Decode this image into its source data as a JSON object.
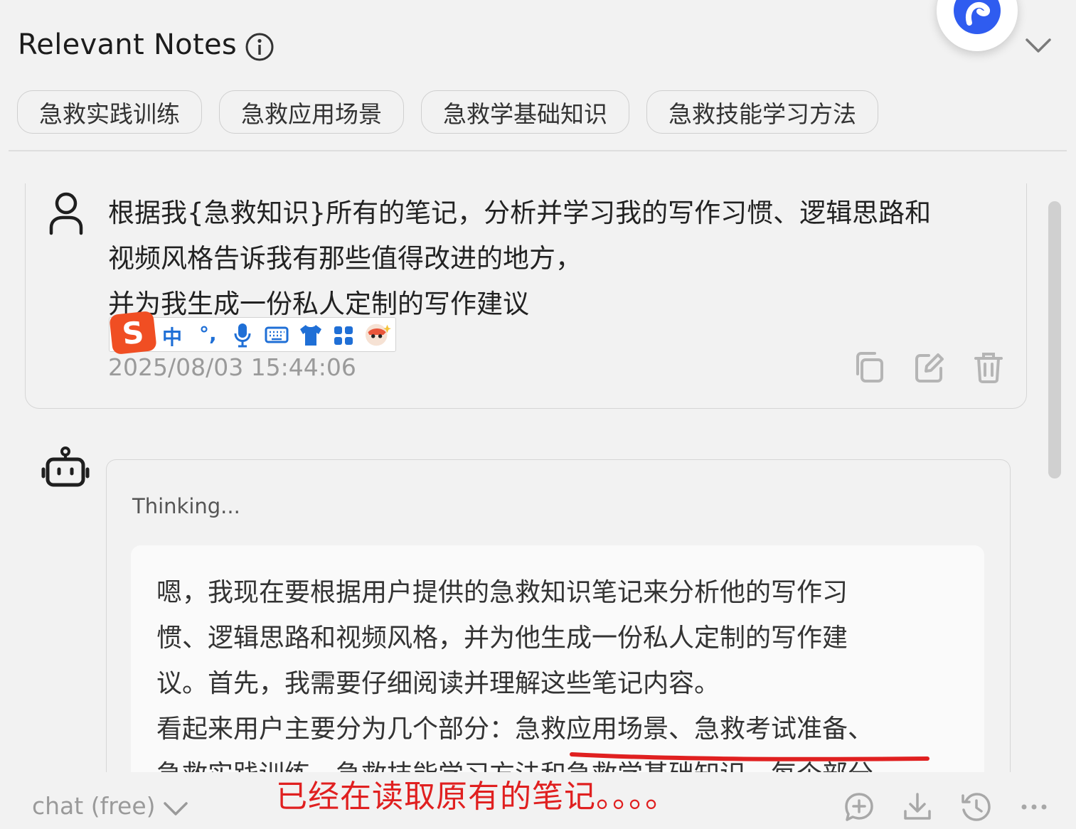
{
  "header": {
    "title": "Relevant Notes"
  },
  "tags": [
    "急救实践训练",
    "急救应用场景",
    "急救学基础知识",
    "急救技能学习方法"
  ],
  "user_message": {
    "lines": [
      "根据我{急救知识}所有的笔记，分析并学习我的写作习惯、逻辑思路和",
      "视频风格告诉我有那些值得改进的地方，",
      "并为我生成一份私人定制的写作建议"
    ],
    "timestamp": "2025/08/03 15:44:06"
  },
  "ime_toolbar": {
    "logo": "S",
    "mode": "中",
    "punct": "°,"
  },
  "bot_message": {
    "thinking_label": "Thinking...",
    "thinking_lines": [
      "嗯，我现在要根据用户提供的急救知识笔记来分析他的写作习",
      "惯、逻辑思路和视频风格，并为他生成一份私人定制的写作建",
      "议。首先，我需要仔细阅读并理解这些笔记内容。",
      "看起来用户主要分为几个部分：急救应用场景、急救考试准备、",
      "急救实践训练、急救技能学习方法和急救学基础知识。每个部分"
    ]
  },
  "footer": {
    "model_label": "chat (free)",
    "annotation": "已经在读取原有的笔记。。。。"
  },
  "colors": {
    "accent": "#2f5cf0",
    "annotation_red": "#e02020",
    "ime_blue": "#1f6fd6"
  }
}
